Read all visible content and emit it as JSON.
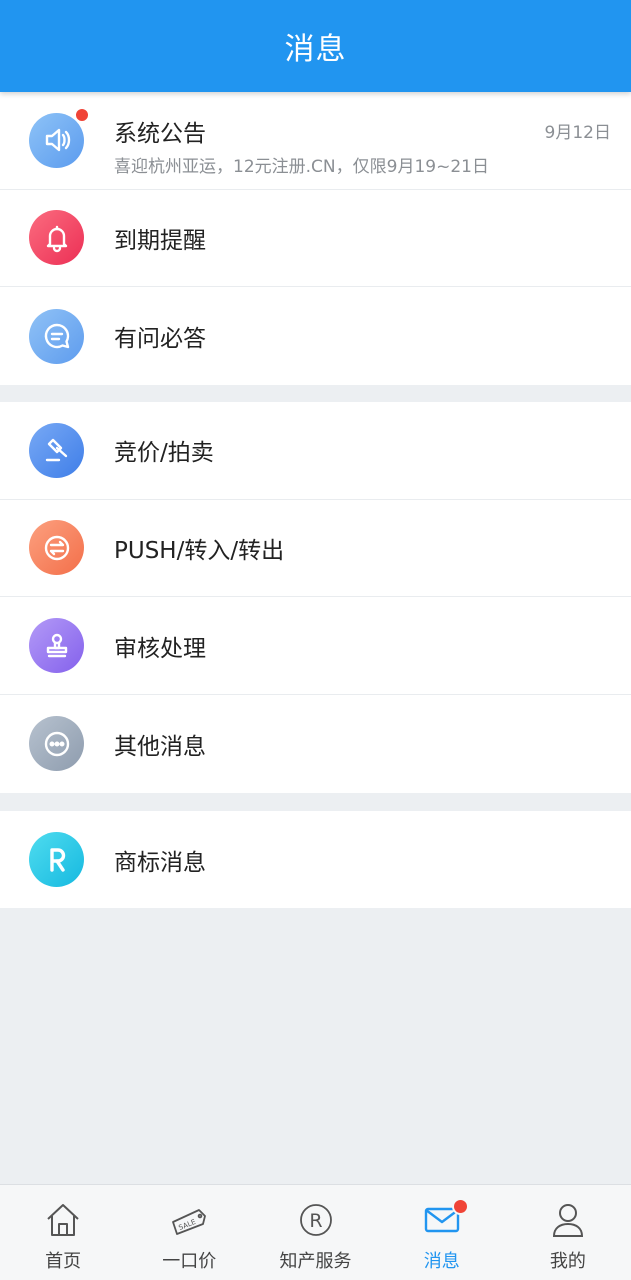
{
  "header": {
    "title": "消息"
  },
  "groups": [
    {
      "items": [
        {
          "label": "系统公告",
          "subtitle": "喜迎杭州亚运，12元注册.CN，仅限9月19~21日",
          "date": "9月12日",
          "icon": "speaker-icon",
          "color": "#6aa8f0",
          "unread": true
        },
        {
          "label": "到期提醒",
          "icon": "bell-icon",
          "color": "#f0415e"
        },
        {
          "label": "有问必答",
          "icon": "chat-icon",
          "color": "#68a6ef"
        }
      ]
    },
    {
      "items": [
        {
          "label": "竞价/拍卖",
          "icon": "gavel-icon",
          "color": "#4f8bed"
        },
        {
          "label": "PUSH/转入/转出",
          "icon": "transfer-icon",
          "color": "#f7835c"
        },
        {
          "label": "审核处理",
          "icon": "stamp-icon",
          "color": "#9a7af0"
        },
        {
          "label": "其他消息",
          "icon": "more-icon",
          "color": "#9eabbb"
        }
      ]
    },
    {
      "items": [
        {
          "label": "商标消息",
          "icon": "trademark-r-icon",
          "color": "#22c8e6"
        }
      ]
    }
  ],
  "tabbar": {
    "tabs": [
      {
        "label": "首页",
        "icon": "home-icon"
      },
      {
        "label": "一口价",
        "icon": "sale-tag-icon",
        "tag_text": "SALE"
      },
      {
        "label": "知产服务",
        "icon": "registered-icon",
        "glyph": "R"
      },
      {
        "label": "消息",
        "icon": "mail-icon",
        "active": true,
        "badge": true
      },
      {
        "label": "我的",
        "icon": "user-icon"
      }
    ],
    "active_color": "#2195f0"
  }
}
